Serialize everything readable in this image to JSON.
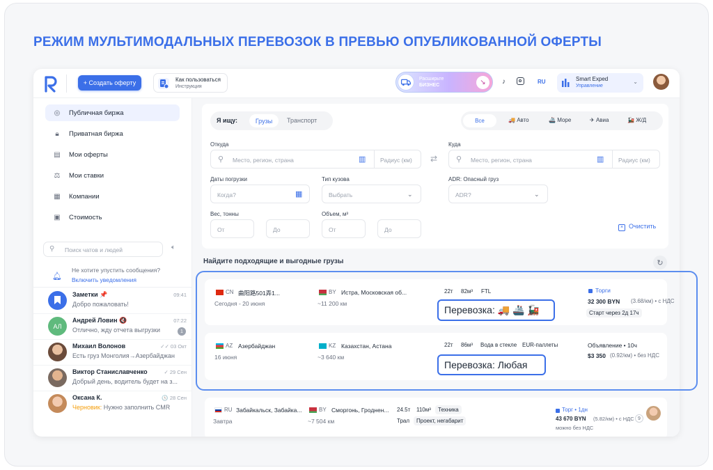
{
  "headline": "РЕЖИМ МУЛЬТИМОДАЛЬНЫХ ПЕРЕВОЗОК В ПРЕВЬЮ ОПУБЛИКОВАННОЙ ОФЕРТЫ",
  "colors": {
    "accent": "#3b6fe8",
    "active_bg": "#eef2ff",
    "page_bg": "#f6f7f9"
  },
  "topbar": {
    "create_label": "+ Создать оферту",
    "howto_title": "Как пользоваться",
    "howto_sub": "Инструкция",
    "biz_title": "Расширьте",
    "biz_sub": "БИЗНЕС",
    "lang": "RU",
    "company_name": "Smart Exped",
    "company_role": "Управление"
  },
  "sidebar": {
    "items": [
      {
        "label": "Публичная биржа",
        "icon": "globe-icon"
      },
      {
        "label": "Приватная биржа",
        "icon": "lock-icon"
      },
      {
        "label": "Мои оферты",
        "icon": "document-icon"
      },
      {
        "label": "Мои ставки",
        "icon": "auction-icon"
      },
      {
        "label": "Компании",
        "icon": "building-icon"
      },
      {
        "label": "Стоимость",
        "icon": "calculator-icon"
      }
    ],
    "search_placeholder": "Поиск чатов и людей",
    "notif_text": "Не хотите упустить сообщения?",
    "notif_link": "Включить уведомления",
    "chats": [
      {
        "name": "Заметки 📌",
        "time": "09:41",
        "preview": "Добро пожаловать!"
      },
      {
        "name": "Андрей Ловин 🔇",
        "time": "07:22",
        "preview": "Отлично, жду отчета выгрузки",
        "badge": "1",
        "initials": "АЛ"
      },
      {
        "name": "Михаил Волонов",
        "time": "✓✓ 03 Окт",
        "preview": "Есть груз Монголия→Азербайджан"
      },
      {
        "name": "Виктор Станиславченко",
        "time": "✓ 29 Сен",
        "preview": "Добрый день, водитель будет на з..."
      },
      {
        "name": "Оксана К.",
        "time": "🕓 28 Сен",
        "preview_prefix": "Черновик:",
        "preview": " Нужно заполнить CMR"
      }
    ]
  },
  "search": {
    "looking_for": "Я ищу:",
    "tab_cargo": "Грузы",
    "tab_transport": "Транспорт",
    "mode_all": "Все",
    "modes": [
      "Авто",
      "Море",
      "Авиа",
      "Ж/Д"
    ],
    "from_label": "Откуда",
    "to_label": "Куда",
    "place_placeholder": "Место, регион, страна",
    "radius_placeholder": "Радиус (км)",
    "dates_label": "Даты погрузки",
    "dates_placeholder": "Когда?",
    "body_label": "Тип кузова",
    "body_placeholder": "Выбрать",
    "adr_label": "ADR: Опасный груз",
    "adr_placeholder": "ADR?",
    "weight_label": "Вес, тонны",
    "volume_label": "Объем, м³",
    "from_ph": "От",
    "to_ph": "До",
    "clear_label": "Очистить"
  },
  "results": {
    "title": "Найдите подходящие и выгодные грузы",
    "cards": [
      {
        "from_cc": "CN",
        "from_city": "曲阳路501弄1...",
        "from_date": "Сегодня - 20 июня",
        "to_cc": "BY",
        "to_city": "Истра, Московская об...",
        "distance": "~11 200 км",
        "tags": [
          "22т",
          "82м³",
          "FTL"
        ],
        "mode_label": "Перевозка: 🚚 🚢 🚂",
        "status": "Торги",
        "price": "32 300 BYN",
        "price_note": "(3.68/км) • с НДС",
        "extra": "Старт через 2д 17ч"
      },
      {
        "from_cc": "AZ",
        "from_city": "Азербайджан",
        "from_date": "16 июня",
        "to_cc": "KZ",
        "to_city": "Казахстан, Астана",
        "distance": "~3 640 км",
        "tags": [
          "22т",
          "86м³",
          "Вода в стекле",
          "EUR-паллеты"
        ],
        "mode_label": "Перевозка: Любая",
        "status": "Объявление • 10ч",
        "price": "$3 350",
        "price_note": "(0.92/км) • без НДС"
      },
      {
        "from_cc": "RU",
        "from_city": "Забайкальск, Забайка...",
        "from_date": "Завтра",
        "to_cc": "BY",
        "to_city": "Сморгонь, Гроднен...",
        "distance": "~7 504 км",
        "tags": [
          "24.5т",
          "110м³",
          "Техника",
          "Трал",
          "Проект, негабарит"
        ],
        "status": "Торг • 1дн",
        "price": "43 670 BYN",
        "price_note": "(5.82/км) • с НДС",
        "extra": "можно без НДС",
        "badge": "9"
      }
    ]
  }
}
